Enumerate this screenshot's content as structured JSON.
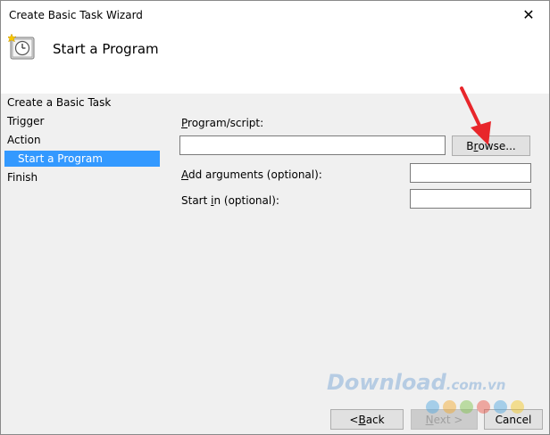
{
  "window": {
    "title": "Create Basic Task Wizard",
    "close_glyph": "✕"
  },
  "header": {
    "heading": "Start a Program",
    "icon": "clock-task-icon"
  },
  "sidebar": {
    "items": [
      {
        "label": "Create a Basic Task"
      },
      {
        "label": "Trigger"
      },
      {
        "label": "Action"
      },
      {
        "label": "Start a Program",
        "selected": true
      },
      {
        "label": "Finish"
      }
    ]
  },
  "form": {
    "program_label_u": "P",
    "program_label_rest": "rogram/script:",
    "program_value": "",
    "browse_label_pre": "B",
    "browse_label_u": "r",
    "browse_label_post": "owse...",
    "args_label_u": "A",
    "args_label_rest": "dd arguments (optional):",
    "args_value": "",
    "start_label_pre": "Start ",
    "start_label_u": "i",
    "start_label_post": "n (optional):",
    "start_value": ""
  },
  "footer": {
    "back_pre": "< ",
    "back_u": "B",
    "back_post": "ack",
    "next_u": "N",
    "next_post": "ext >",
    "cancel": "Cancel"
  },
  "watermark": {
    "text": "Download",
    "suffix": ".com.vn"
  },
  "colors": {
    "selection": "#3399ff",
    "arrow": "#e8262b",
    "dots": [
      "#4aa3df",
      "#f5a623",
      "#7ac143",
      "#e94b3c",
      "#4aa3df",
      "#f5c518"
    ]
  }
}
